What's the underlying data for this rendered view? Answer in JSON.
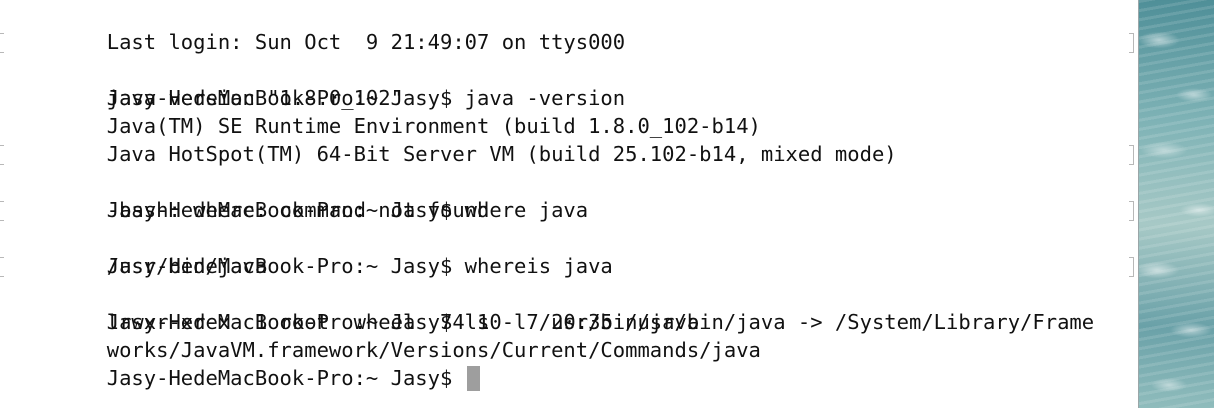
{
  "terminal": {
    "lines": [
      {
        "text": "Last login: Sun Oct  9 21:49:07 on ttys000",
        "marked": false
      },
      {
        "text": "Jasy-HedeMacBook-Pro:~ Jasy$ java -version",
        "marked": true
      },
      {
        "text": "java version \"1.8.0_102\"",
        "marked": false
      },
      {
        "text": "Java(TM) SE Runtime Environment (build 1.8.0_102-b14)",
        "marked": false
      },
      {
        "text": "Java HotSpot(TM) 64-Bit Server VM (build 25.102-b14, mixed mode)",
        "marked": false
      },
      {
        "text": "Jasy-HedeMacBook-Pro:~ Jasy$ where java",
        "marked": true
      },
      {
        "text": "-bash: where: command not found",
        "marked": false
      },
      {
        "text": "Jasy-HedeMacBook-Pro:~ Jasy$ whereis java",
        "marked": true
      },
      {
        "text": "/usr/bin/java",
        "marked": false
      },
      {
        "text": "Jasy-HedeMacBook-Pro:~ Jasy$ ls -l /usr/bin/java",
        "marked": true
      },
      {
        "text": "lrwxr-xr-x  1 root  wheel  74 10  7 20:35 /usr/bin/java -> /System/Library/Frame",
        "marked": false
      },
      {
        "text": "works/JavaVM.framework/Versions/Current/Commands/java",
        "marked": false
      }
    ],
    "prompt": "Jasy-HedeMacBook-Pro:~ Jasy$ ",
    "colors": {
      "background": "#ffffff",
      "text": "#111111",
      "cursor": "#9e9e9e"
    }
  }
}
